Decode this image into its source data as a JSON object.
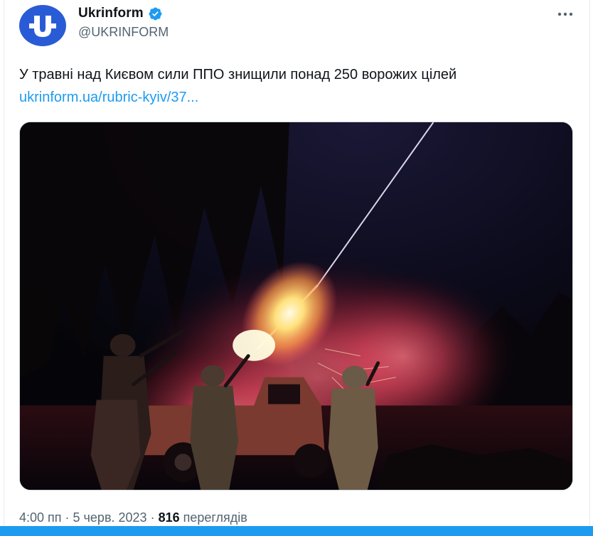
{
  "author": {
    "display_name": "Ukrinform",
    "handle": "@UKRINFORM",
    "verified": true,
    "avatar_letter": "U",
    "avatar_color": "#2a5bd7"
  },
  "tweet": {
    "text": "У травні над Києвом сили ППО знищили понад 250 ворожих цілей",
    "link": "ukrinform.ua/rubric-kyiv/37..."
  },
  "photo": {
    "description_icon": "photo-air-defense-night"
  },
  "meta": {
    "time": "4:00 пп",
    "separator": "·",
    "date": "5 черв. 2023",
    "views_count": "816",
    "views_label": "переглядів"
  },
  "colors": {
    "accent": "#1d9bf0",
    "text_primary": "#0f1419",
    "text_secondary": "#536471"
  }
}
